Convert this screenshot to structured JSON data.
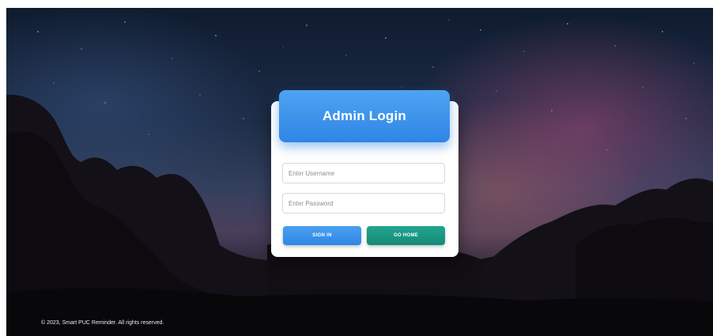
{
  "login": {
    "title": "Admin Login",
    "username": {
      "value": "",
      "placeholder": "Enter Username"
    },
    "password": {
      "value": "",
      "placeholder": "Enter Password"
    },
    "signin_label": "SIGN IN",
    "gohome_label": "GO HOME"
  },
  "footer": {
    "text": "© 2023, Smart PUC Reminder. All rights reserved."
  },
  "colors": {
    "header_blue": "#3a92ec",
    "signin_blue": "#3a92ec",
    "gohome_teal": "#1a9a84",
    "card_bg": "#ffffff"
  },
  "icons": []
}
